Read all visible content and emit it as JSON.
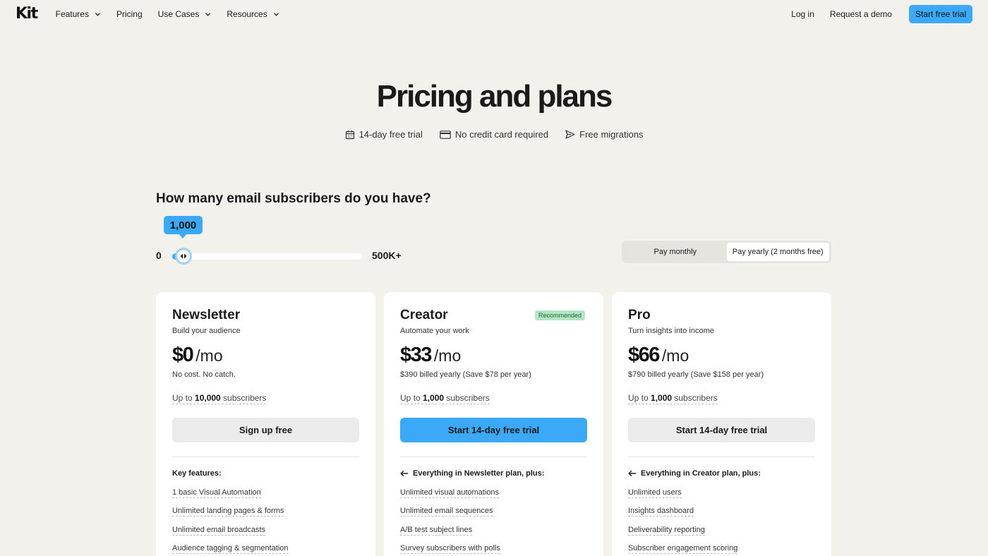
{
  "nav": {
    "logo": "Kit",
    "items": [
      {
        "label": "Features",
        "has_dropdown": true
      },
      {
        "label": "Pricing",
        "has_dropdown": false
      },
      {
        "label": "Use Cases",
        "has_dropdown": true
      },
      {
        "label": "Resources",
        "has_dropdown": true
      }
    ],
    "login": "Log in",
    "demo": "Request a demo",
    "cta": "Start free trial"
  },
  "hero": {
    "title": "Pricing and plans",
    "perks": [
      {
        "icon": "calendar-icon",
        "label": "14-day free trial"
      },
      {
        "icon": "credit-card-icon",
        "label": "No credit card required"
      },
      {
        "icon": "send-icon",
        "label": "Free migrations"
      }
    ]
  },
  "subscribers": {
    "question": "How many email subscribers do you have?",
    "value": "1,000",
    "min_label": "0",
    "max_label": "500K+",
    "slider_fraction": 0.06
  },
  "billing_toggle": {
    "monthly": "Pay monthly",
    "yearly": "Pay yearly",
    "yearly_note": "(2 months free)",
    "selected": "yearly"
  },
  "plans": [
    {
      "name": "Newsletter",
      "tagline": "Build your audience",
      "badge": "",
      "price": "$0",
      "per": "/mo",
      "billing": "No cost. No catch.",
      "limit_prefix": "Up to ",
      "limit_count": "10,000",
      "limit_suffix": " subscribers",
      "button": "Sign up free",
      "features_head": "Key features:",
      "features": [
        "1 basic Visual Automation",
        "Unlimited landing pages & forms",
        "Unlimited email broadcasts",
        "Audience tagging & segmentation"
      ]
    },
    {
      "name": "Creator",
      "tagline": "Automate your work",
      "badge": "Recommended",
      "price": "$33",
      "per": "/mo",
      "billing": "$390 billed yearly (Save $78 per year)",
      "limit_prefix": "Up to ",
      "limit_count": "1,000",
      "limit_suffix": " subscribers",
      "button": "Start 14-day free trial",
      "features_head": "Everything in Newsletter plan, plus:",
      "features": [
        "Unlimited visual automations",
        "Unlimited email sequences",
        "A/B test subject lines",
        "Survey subscribers with polls"
      ]
    },
    {
      "name": "Pro",
      "tagline": "Turn insights into income",
      "badge": "",
      "price": "$66",
      "per": "/mo",
      "billing": "$790 billed yearly (Save $158 per year)",
      "limit_prefix": "Up to ",
      "limit_count": "1,000",
      "limit_suffix": " subscribers",
      "button": "Start 14-day free trial",
      "features_head": "Everything in Creator plan, plus:",
      "features": [
        "Unlimited users",
        "Insights dashboard",
        "Deliverability reporting",
        "Subscriber engagement scoring"
      ]
    }
  ],
  "colors": {
    "accent": "#3ba8f8",
    "background": "#f3f1ec",
    "badge_bg": "#b3e6c4",
    "badge_text": "#1d6a37"
  }
}
